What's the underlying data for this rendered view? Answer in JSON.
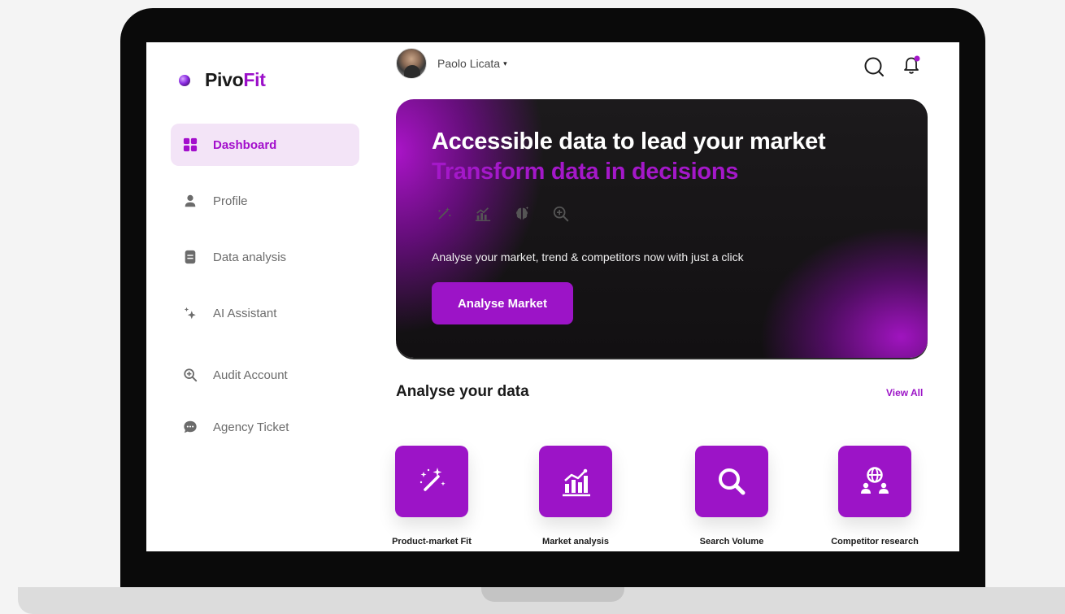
{
  "app": {
    "logo_prefix": "Pivo",
    "logo_accent": "Fit"
  },
  "sidebar": {
    "items": [
      {
        "label": "Dashboard",
        "icon": "grid-icon",
        "active": true
      },
      {
        "label": "Profile",
        "icon": "user-icon"
      },
      {
        "label": "Data analysis",
        "icon": "document-icon"
      },
      {
        "label": "AI Assistant",
        "icon": "sparkle-icon"
      },
      {
        "label": "Audit Account",
        "icon": "zoom-search-icon"
      },
      {
        "label": "Agency Ticket",
        "icon": "chat-bubble-icon"
      }
    ]
  },
  "header": {
    "user_name": "Paolo Licata",
    "caret": "▾",
    "icons": [
      "search-icon",
      "notification-bell-icon"
    ]
  },
  "hero": {
    "title": "Accessible data to lead your market",
    "subtitle": "Transform data in decisions",
    "icons": [
      "magic-wand-icon",
      "chart-icon",
      "brain-icon",
      "zoom-search-icon"
    ],
    "description": "Analyse your market, trend & competitors now with just a click",
    "button_label": "Analyse Market"
  },
  "analyse": {
    "title": "Analyse your data",
    "view_all": "View All",
    "cards": [
      {
        "label": "Product-market Fit",
        "icon": "magic-wand-icon"
      },
      {
        "label": "Market analysis",
        "icon": "bar-chart-icon"
      },
      {
        "label": "Search Volume",
        "icon": "search-icon"
      },
      {
        "label": "Competitor research",
        "icon": "globe-users-icon"
      }
    ]
  },
  "colors": {
    "accent": "#9c14c7",
    "active_bg": "#f3e4f7",
    "dark": "#121012"
  }
}
